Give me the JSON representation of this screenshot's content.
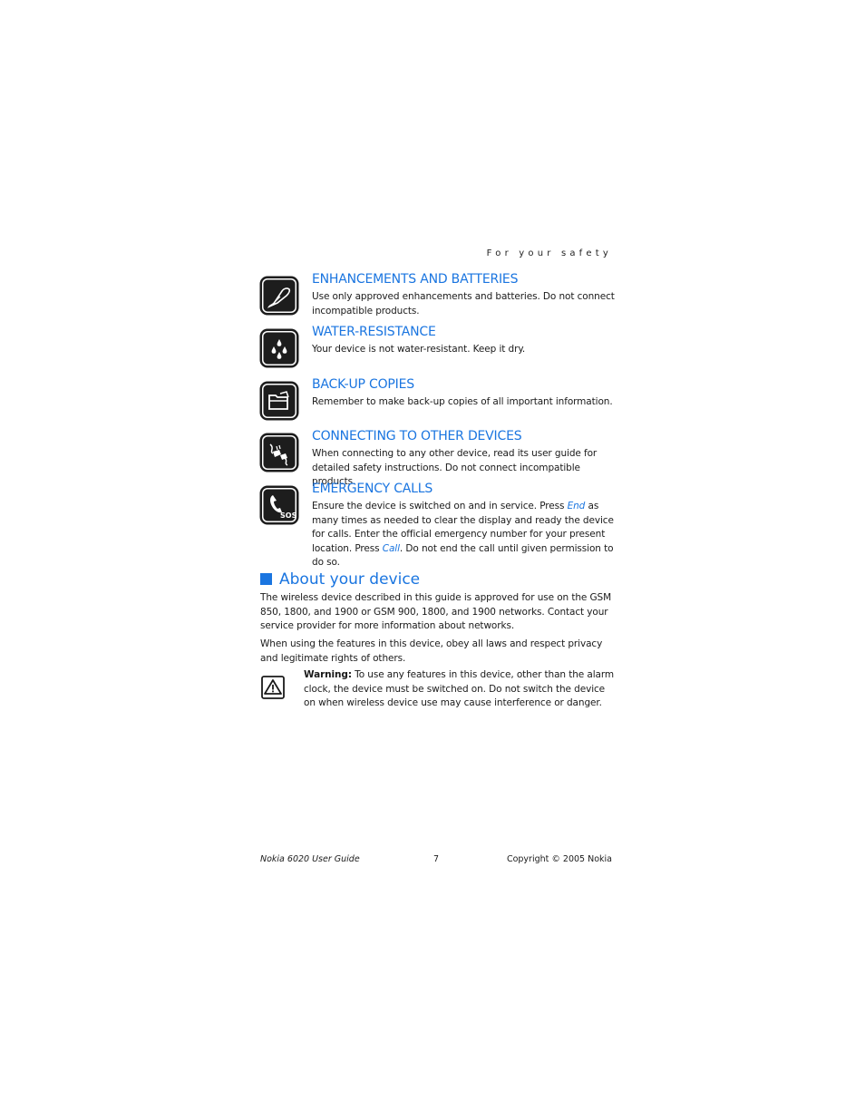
{
  "header": {
    "section": "For your safety"
  },
  "safety_items": [
    {
      "icon": "enhancement-plug-icon",
      "title": "ENHANCEMENTS AND BATTERIES",
      "text": "Use only approved enhancements and batteries. Do not connect incompatible products."
    },
    {
      "icon": "water-drops-icon",
      "title": "WATER-RESISTANCE",
      "text": "Your device is not water-resistant. Keep it dry."
    },
    {
      "icon": "folder-backup-icon",
      "title": "BACK-UP COPIES",
      "text": "Remember to make back-up copies of all important information."
    },
    {
      "icon": "connecting-plugs-icon",
      "title": "CONNECTING TO OTHER DEVICES",
      "text": "When connecting to any other device, read its user guide for detailed safety instructions. Do not connect incompatible products."
    },
    {
      "icon": "sos-phone-icon",
      "title": "EMERGENCY CALLS",
      "text_parts": {
        "part1": "Ensure the device is switched on and in service. Press ",
        "softkey1": "End",
        "part2": " as many times as needed to clear the display and ready the device for calls. Enter the official emergency number for your present location. Press ",
        "softkey2": "Call",
        "part3": ". Do not end the call until given permission to do so."
      }
    }
  ],
  "about": {
    "title": "About your device",
    "paragraph1": "The wireless device described in this guide is approved for use on the GSM 850, 1800, and 1900 or GSM 900, 1800, and 1900 networks. Contact your service provider for more information about networks.",
    "paragraph2": "When using the features in this device, obey all laws and respect privacy and legitimate rights of others.",
    "warning_label": "Warning:",
    "warning_text": " To use any features in this device, other than the alarm clock, the device must be switched on. Do not switch the device on when wireless device use may cause interference or danger."
  },
  "footer": {
    "left": "Nokia 6020 User Guide",
    "page_number": "7",
    "right": "Copyright © 2005 Nokia"
  },
  "colors": {
    "accent": "#1a75e0",
    "text": "#1a1a1a",
    "icon_bg": "#1d1d1d"
  }
}
